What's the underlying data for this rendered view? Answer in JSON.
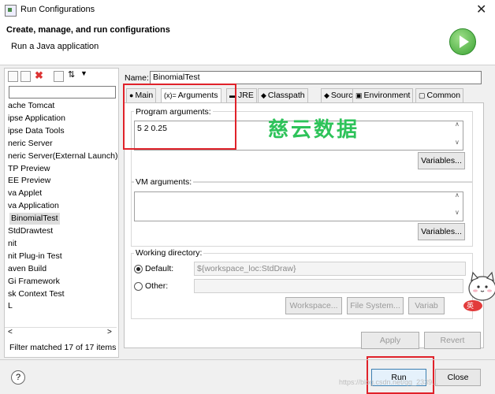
{
  "window": {
    "title": "Run Configurations",
    "close_glyph": "✕"
  },
  "header": {
    "title": "Create, manage, and run configurations",
    "subtitle": "Run a Java application"
  },
  "left": {
    "filter_value": "",
    "items": [
      "ache Tomcat",
      "ipse Application",
      "ipse Data Tools",
      "neric Server",
      "neric Server(External Launch)",
      "TP Preview",
      "EE Preview",
      "va Applet",
      "va Application",
      "BinomialTest",
      "StdDrawtest",
      "nit",
      "nit Plug-in Test",
      "aven Build",
      "Gi Framework",
      "sk Context Test",
      "L"
    ],
    "selected_index": 9,
    "filter_status": "Filter matched 17 of 17 items",
    "scroll_left": "<",
    "scroll_right": ">"
  },
  "config": {
    "name_label": "Name:",
    "name_value": "BinomialTest",
    "tabs": [
      {
        "label": "Main",
        "icon": "main-icon",
        "glyph": "●"
      },
      {
        "label": "Arguments",
        "icon": "arguments-icon",
        "glyph": "(x)="
      },
      {
        "label": "JRE",
        "icon": "jre-icon",
        "glyph": "▬"
      },
      {
        "label": "Classpath",
        "icon": "classpath-icon",
        "glyph": "◆"
      },
      {
        "label": "Source",
        "icon": "source-icon",
        "glyph": "◆"
      },
      {
        "label": "Environment",
        "icon": "environment-icon",
        "glyph": "▣"
      },
      {
        "label": "Common",
        "icon": "common-icon",
        "glyph": "▢"
      }
    ],
    "active_tab": 1,
    "program_args_label": "Program arguments:",
    "program_args_value": "5 2 0.25",
    "vm_args_label": "VM arguments:",
    "vm_args_value": "",
    "variables_label": "Variables...",
    "working_dir_label": "Working directory:",
    "default_label": "Default:",
    "default_value": "${workspace_loc:StdDraw}",
    "other_label": "Other:",
    "workspace_btn": "Workspace...",
    "filesystem_btn": "File System...",
    "variables_btn_short": "Variab",
    "apply": "Apply",
    "revert": "Revert"
  },
  "footer": {
    "help_glyph": "?",
    "run": "Run",
    "close": "Close",
    "url_text": "https://blog.csdn.net/qq_2339..."
  },
  "watermark": {
    "text": "慈云数据",
    "color": "#2ec35a"
  },
  "sticker": {
    "text": "英"
  },
  "colors": {
    "highlight": "#e0222a",
    "run_green": "#3aa232"
  }
}
